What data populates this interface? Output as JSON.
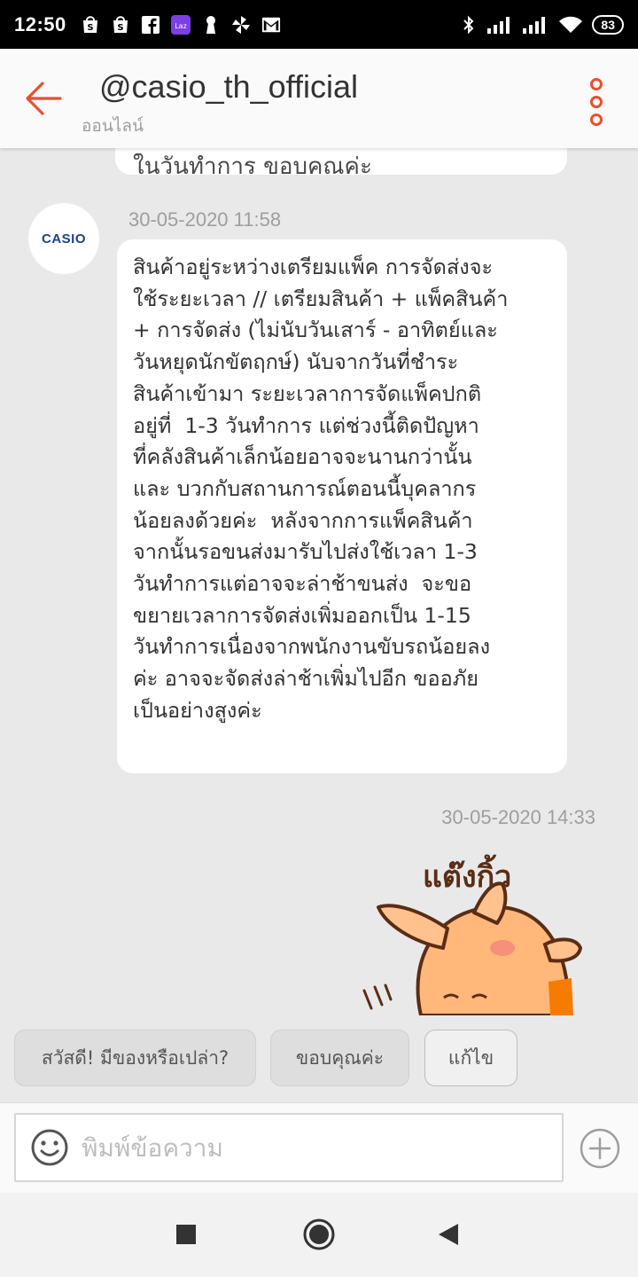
{
  "status_bar": {
    "time": "12:50",
    "battery": "83",
    "left_icons": [
      "shopee-icon",
      "shopee-icon",
      "facebook-icon",
      "lazada-icon",
      "keyhole-icon",
      "pinwheel-icon",
      "gmail-icon"
    ],
    "right_icons": [
      "bluetooth-icon",
      "signal-icon",
      "signal-icon",
      "wifi-icon",
      "battery-icon"
    ]
  },
  "header": {
    "title": "@casio_th_official",
    "status": "ออนไลน์",
    "accent_color": "#ee4d2d"
  },
  "chat": {
    "previous_message_fragment": "ในวันทำการ ขอบคุณค่ะ",
    "avatar_label": "CASIO",
    "message_1": {
      "timestamp": "30-05-2020 11:58",
      "text": "สินค้าอยู่ระหว่างเตรียมแพ็ค การจัดส่งจะ\nใช้ระยะเวลา // เตรียมสินค้า + แพ็คสินค้า\n+ การจัดส่ง (ไม่นับวันเสาร์ - อาทิตย์และ\nวันหยุดนักขัตฤกษ์) นับจากวันที่ชำระ\nสินค้าเข้ามา ระยะเวลาการจัดแพ็คปกติ\nอยู่ที่  1-3 วันทำการ แต่ช่วงนี้ติดปัญหา\nที่คลังสินค้าเล็กน้อยอาจจะนานกว่านั้น\nและ บวกกับสถานการณ์ตอนนี้บุคลากร\nน้อยลงด้วยค่ะ  หลังจากการแพ็คสินค้า\nจากนั้นรอขนส่งมารับไปส่งใช้เวลา 1-3\nวันทำการแต่อาจจะล่าช้าขนส่ง  จะขอ\nขยายเวลาการจัดส่งเพิ่มออกเป็น 1-15\nวันทำการเนื่องจากพนักงานขับรถน้อยลง\nค่ะ อาจจะจัดส่งล่าช้าเพิ่มไปอีก ขออภัย\nเป็นอย่างสูงค่ะ"
    },
    "message_2": {
      "timestamp": "30-05-2020 14:33",
      "sticker_text": "แต๊งกิ้ว"
    }
  },
  "quick_replies": [
    {
      "label": "สวัสดี! มีของหรือเปล่า?"
    },
    {
      "label": "ขอบคุณค่ะ"
    },
    {
      "label": "แก้ไข"
    }
  ],
  "input": {
    "placeholder": "พิมพ์ข้อความ",
    "value": ""
  },
  "nav": {
    "buttons": [
      "recents-icon",
      "home-icon",
      "back-icon"
    ]
  }
}
